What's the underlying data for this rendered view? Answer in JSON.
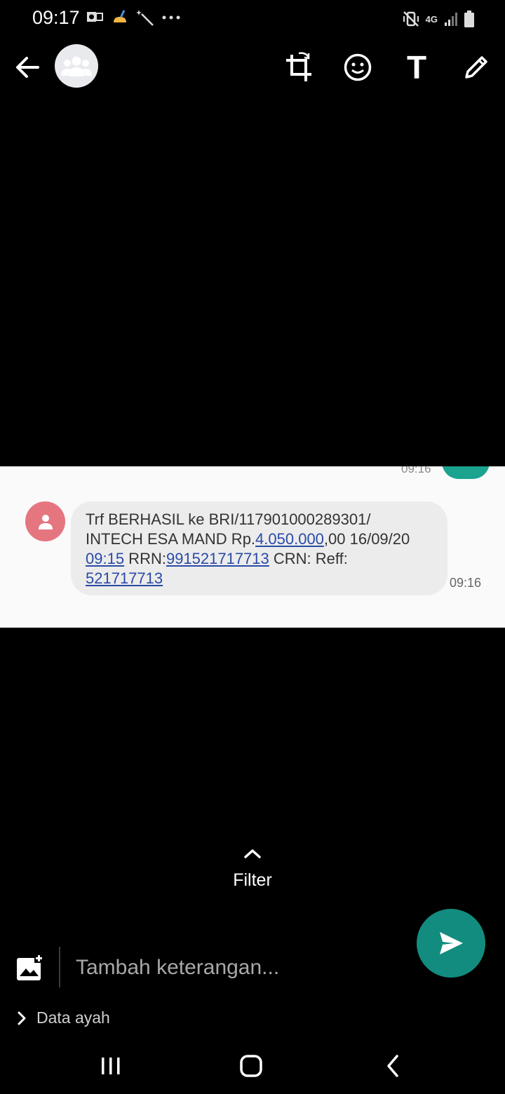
{
  "status_bar": {
    "time": "09:17",
    "left_icons": [
      "outlook-icon",
      "cleaner-icon",
      "magic-wand-icon",
      "more-dots-icon"
    ],
    "right_icons": [
      "mute-vibrate-icon",
      "4g-icon",
      "signal-icon",
      "battery-icon"
    ],
    "network": "4G"
  },
  "toolbar": {
    "tools": [
      "crop-rotate-icon",
      "emoji-icon",
      "text-icon",
      "pencil-icon"
    ],
    "text_tool_label": "T"
  },
  "preview": {
    "previous_time": "09:16",
    "message": {
      "line1": "Trf BERHASIL ke BRI/117901000289301/",
      "line2_prefix": "INTECH ESA MAND Rp.",
      "amount_link": "4.050.000",
      "line2_suffix": ",00 16/09/20",
      "time_link": "09:15",
      "rrn_label": " RRN:",
      "rrn_link": "991521717713",
      "crn_label": " CRN: Reff:",
      "reff_link": "521717713"
    },
    "time": "09:16"
  },
  "filter": {
    "label": "Filter"
  },
  "caption": {
    "placeholder": "Tambah keterangan..."
  },
  "recipient": {
    "label": "Data ayah"
  },
  "colors": {
    "accent": "#128c7e",
    "link": "#2a4aa6",
    "bubble": "#ececec",
    "sender_avatar": "#e57680"
  }
}
